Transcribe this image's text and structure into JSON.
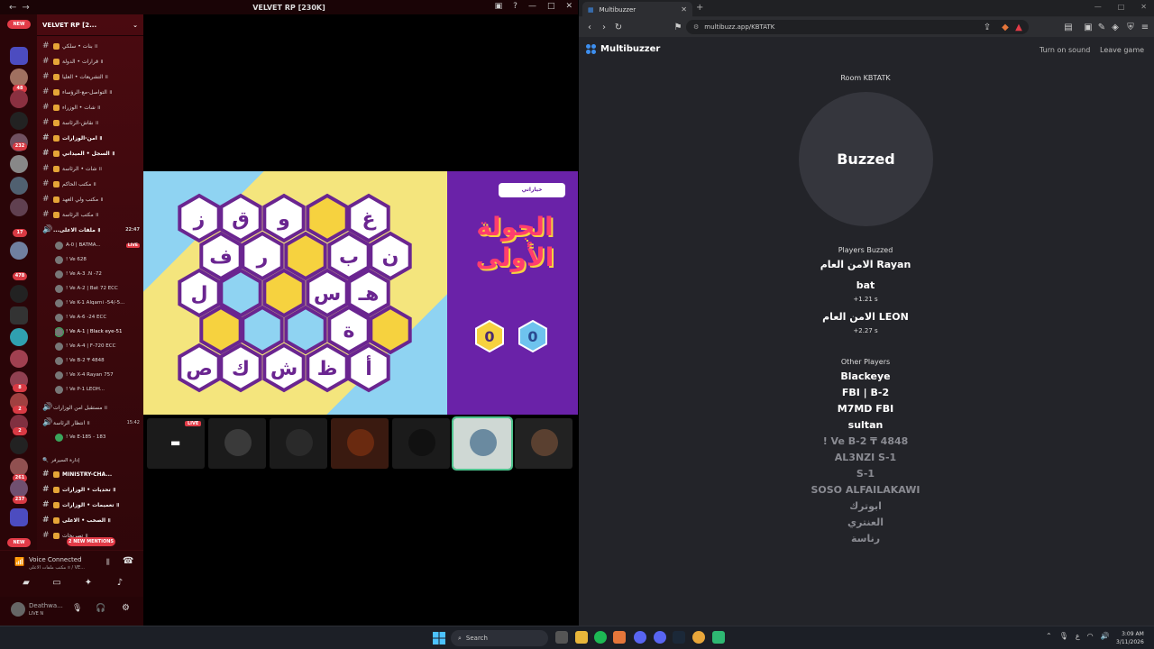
{
  "discord": {
    "window_title": "VELVET RP [230K]",
    "server_name": "VELVET RP [2...",
    "new_badge": "NEW",
    "server_badges": [
      "48",
      "232",
      "17",
      "478",
      "8",
      "2",
      "2",
      "261",
      "237"
    ],
    "channels": [
      "بنات • سلكي ॥",
      "قرارات • الدولة ॥",
      "التشريعات • العليا ॥",
      "التواصل-مع-الرؤساء ॥",
      "شات • الوزراء ॥",
      "نقاش-الرئاسة ॥",
      "امن-الوزارات ॥",
      "السجل • الميداني ॥",
      "شات • الرئاسة ॥",
      "مكتب الحاكم ॥",
      "مكتب ولي العهد ॥",
      "مكتب الرئاسة ॥"
    ],
    "voice_channel": {
      "name": "...ملفات الاعلى ॥",
      "time": "22:47"
    },
    "voice_users": [
      {
        "name": "A-0 | BATMA...",
        "live": "LIVE"
      },
      {
        "name": "! Ve 628"
      },
      {
        "name": "! Ve A-3 .N -72"
      },
      {
        "name": "! Ve A-2 | Bat 72 ECC"
      },
      {
        "name": "! Ve K-1 Alqarni -54/-5..."
      },
      {
        "name": "! Ve A-6 -24 ECC"
      },
      {
        "name": "! Ve A-1 | Black eye-51"
      },
      {
        "name": "! Ve A-4 | F-720 ECC"
      },
      {
        "name": "! Ve B-2 ₸ 4848"
      },
      {
        "name": "! Ve X-4 Rayan 757"
      },
      {
        "name": "! Ve P-1 LEOH..."
      }
    ],
    "lower_channels": [
      {
        "name": "مستقبل امن الوزارات ॥"
      },
      {
        "name": "انتظار الرئاسة ॥",
        "time": "15:42"
      },
      {
        "name": "! Ve E-185 - 183"
      }
    ],
    "category": "إدارة السيرفر",
    "category_channels": [
      "MINISTRY-CHA...",
      "تحديات • الوزارات ॥",
      "تعميمات • الوزارات ॥",
      "الصخب • الاعلى ॥",
      "تصريحات ॥"
    ],
    "mentions": "2 NEW MENTIONS",
    "voice_status": "Voice Connected",
    "voice_detail": "مكتب ملفات الاعلى ॥ / VE...",
    "user_name": "Deathwa...",
    "user_status": "LIVE N",
    "game": {
      "side_button": "خياراتي",
      "round_title_1": "الجولة",
      "round_title_2": "الأولى",
      "score_left": "0",
      "score_right": "0",
      "letters": [
        "ز",
        "ق",
        "و",
        "غ",
        "ف",
        "ر",
        "ب",
        "ن",
        "ل",
        "س",
        "هـ",
        "ة",
        "ص",
        "ك",
        "ش",
        "ظ",
        "أ"
      ]
    },
    "thumb_live": "LIVE"
  },
  "browser": {
    "tab_title": "Multibuzzer",
    "url": "multibuzz.app/KBTATK",
    "app_name": "Multibuzzer",
    "turn_on_sound": "Turn on sound",
    "leave_game": "Leave game",
    "room": "Room KBTATK",
    "buzz_label": "Buzzed",
    "players_buzzed_label": "Players Buzzed",
    "buzzed_players": [
      {
        "name": "الامن العام Rayan",
        "time": ""
      },
      {
        "name": "bat",
        "time": "+1.21 s"
      },
      {
        "name": "الامن العام LEON",
        "time": "+2.27 s"
      }
    ],
    "other_players_label": "Other Players",
    "other_players": [
      {
        "name": "Blackeye",
        "dim": false
      },
      {
        "name": "FBI | B-2",
        "dim": false
      },
      {
        "name": "M7MD FBI",
        "dim": false
      },
      {
        "name": "sultan",
        "dim": false
      },
      {
        "name": "! Ve B-2 ₸ 4848",
        "dim": true
      },
      {
        "name": "AL3NZI S-1",
        "dim": true
      },
      {
        "name": "S-1",
        "dim": true
      },
      {
        "name": "SOSO ALFAILAKAWI",
        "dim": true
      },
      {
        "name": "ابوترك",
        "dim": true
      },
      {
        "name": "العنتري",
        "dim": true
      },
      {
        "name": "رناسة",
        "dim": true
      }
    ]
  },
  "taskbar": {
    "search_placeholder": "Search",
    "time": "3:09 AM",
    "date": "3/11/2026",
    "lang": "ع"
  },
  "colors": {
    "discord_bg": "#2a0508",
    "game_purple": "#6a22a8",
    "hex_fill": "#ffffff",
    "hex_border": "#6a2590",
    "accent_blue": "#3d8ff0"
  }
}
